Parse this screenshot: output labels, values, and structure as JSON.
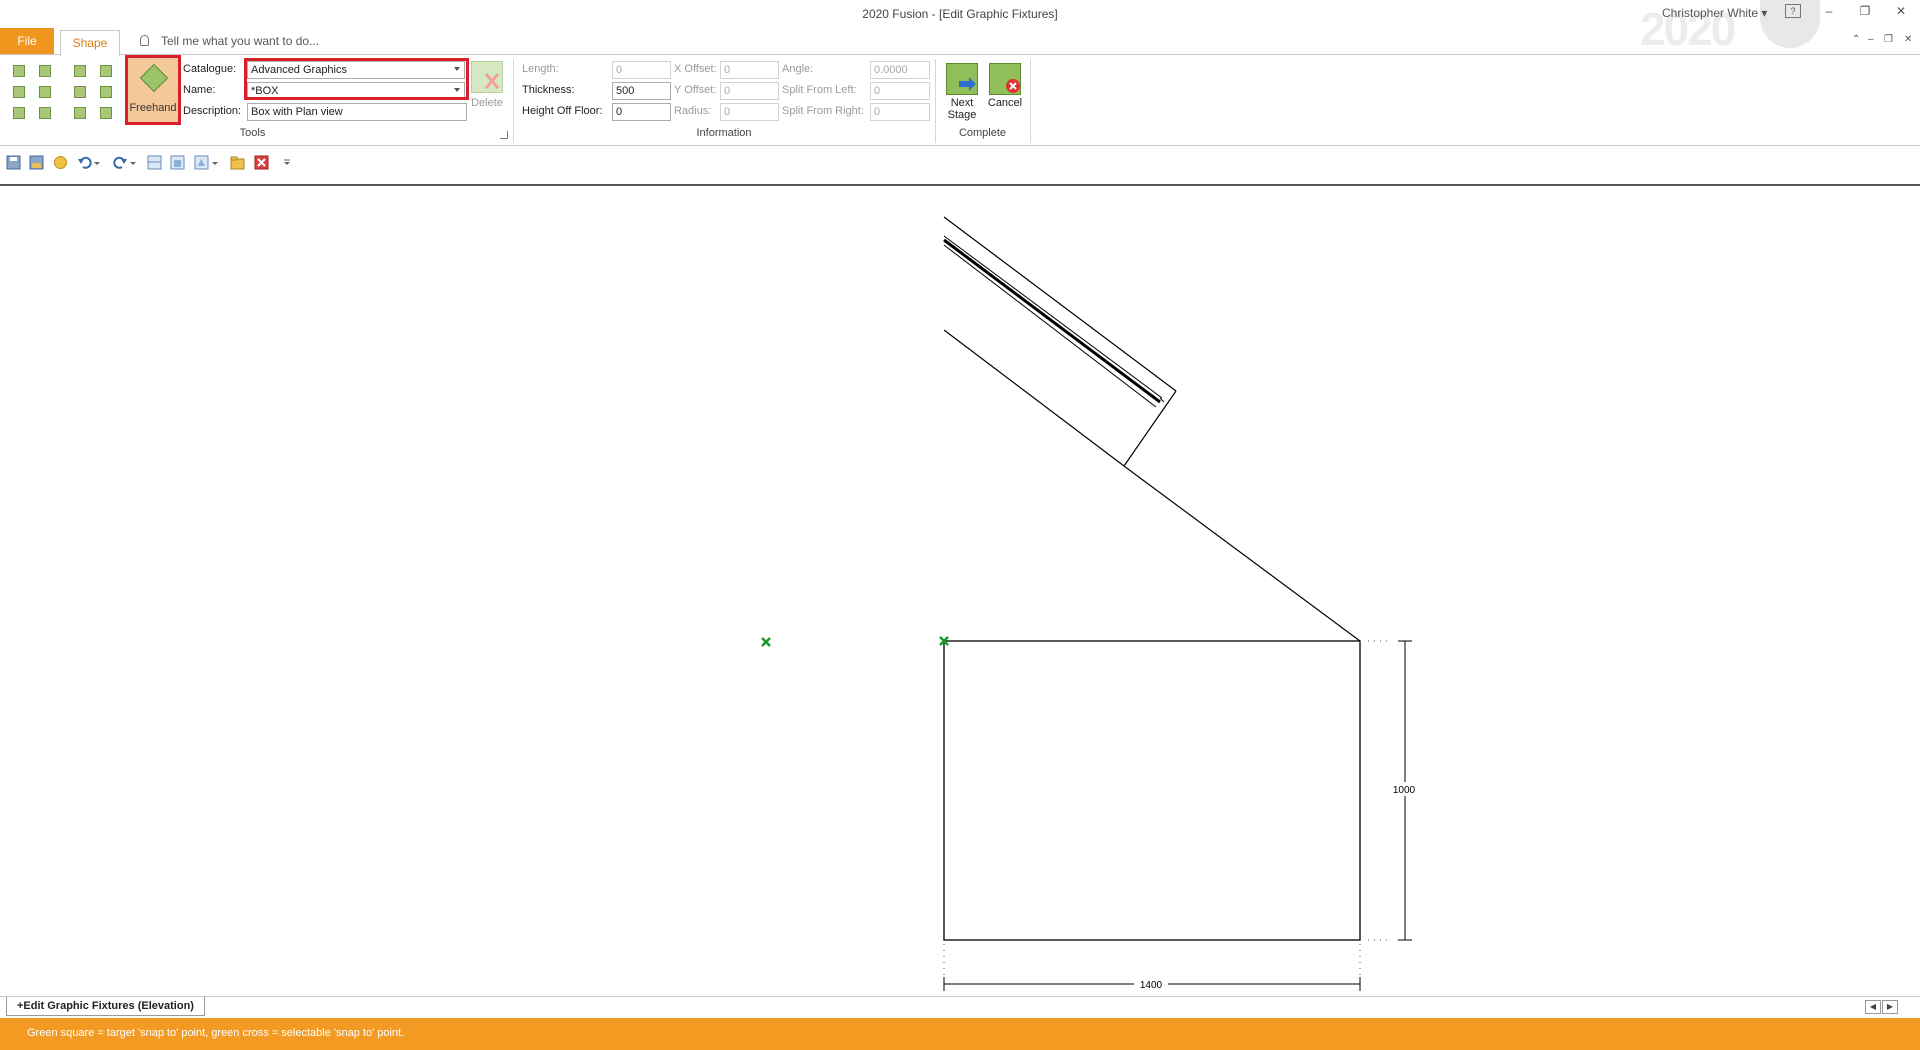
{
  "window": {
    "title": "2020 Fusion - [Edit Graphic Fixtures]",
    "logo_text": "2020",
    "user_name": "Christopher White",
    "user_dropdown_glyph": "▾",
    "minimize_glyph": "–",
    "restore_glyph": "❐",
    "close_glyph": "✕"
  },
  "tabs": {
    "file": "File",
    "shape": "Shape",
    "tell_me_placeholder": "Tell me what you want to do..."
  },
  "ribbon": {
    "tools": {
      "freehand_label": "Freehand",
      "catalogue_label": "Catalogue:",
      "catalogue_value": "Advanced Graphics",
      "name_label": "Name:",
      "name_value": "*BOX",
      "description_label": "Description:",
      "description_value": "Box with Plan view",
      "delete_label": "Delete",
      "group_label": "Tools"
    },
    "information": {
      "length_label": "Length:",
      "length_value": "0",
      "thickness_label": "Thickness:",
      "thickness_value": "500",
      "height_off_floor_label": "Height Off Floor:",
      "height_off_floor_value": "0",
      "x_offset_label": "X Offset:",
      "x_offset_value": "0",
      "y_offset_label": "Y Offset:",
      "y_offset_value": "0",
      "radius_label": "Radius:",
      "radius_value": "0",
      "angle_label": "Angle:",
      "angle_value": "0.0000",
      "split_from_left_label": "Split From Left:",
      "split_from_left_value": "0",
      "split_from_right_label": "Split From Right:",
      "split_from_right_value": "0",
      "group_label": "Information"
    },
    "complete": {
      "next_stage_line1": "Next",
      "next_stage_line2": "Stage",
      "cancel_label": "Cancel",
      "group_label": "Complete"
    }
  },
  "canvas": {
    "dimension_height": "1000",
    "dimension_width": "1400"
  },
  "sheet_tab": "+Edit Graphic Fixtures (Elevation)",
  "status_text": "Green square = target 'snap to' point, green cross = selectable 'snap to' point.",
  "colors": {
    "accent_orange": "#f39a22",
    "highlight_red": "#d81f2a",
    "snap_green": "#1a9a2a"
  }
}
